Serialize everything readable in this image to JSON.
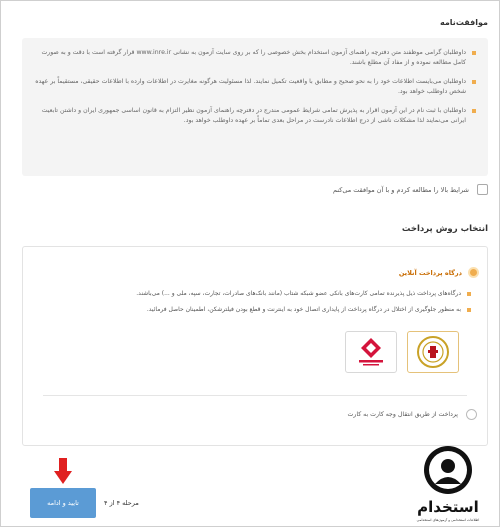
{
  "terms": {
    "title": "موافقت‌نامه",
    "items": [
      "داوطلبان گرامی موظفند متن دفترچه راهنمای آزمون استخدام بخش خصوصی را که بر روی سایت آزمون به نشانی www.inre.ir قرار گرفته است با دقت و به صورت کامل مطالعه نموده و از مفاد آن مطلع باشند.",
      "داوطلبان می‌بایست اطلاعات خود را به نحو صحیح و مطابق با واقعیت تکمیل نمایند. لذا مسئولیت هرگونه مغایرت در اطلاعات وارده با اطلاعات حقیقی، مستقیماً بر عهده شخص داوطلب خواهد بود.",
      "داوطلبان با ثبت نام در این آزمون اقرار به پذیرش تمامی شرایط عمومی مندرج در دفترچه راهنمای آزمون نظیر التزام به قانون اساسی جمهوری ایران و داشتن تابعیت ایرانی می‌نمایند لذا مشکلات ناشی از درج اطلاعات نادرست در مراحل بعدی تماماً بر عهده داوطلب خواهد بود."
    ]
  },
  "agree": {
    "label": "شرایط بالا را مطالعه کردم و با آن موافقت می‌کنم"
  },
  "payment": {
    "title": "انتخاب روش پرداخت",
    "gateway_label": "درگاه پرداخت آنلاین",
    "notes": [
      "درگاه‌های پرداخت ذیل پذیرنده تمامی کارت‌های بانکی عضو شبکه شتاب (مانند بانک‌های صادرات، تجارت، سپه، ملی و ...) می‌باشند.",
      "به منظور جلوگیری از اختلال در درگاه پرداخت از پایداری اتصال خود به اینترنت و قطع بودن فیلترشکن، اطمینان حاصل فرمائید."
    ],
    "banks": [
      {
        "name": "بانک ملی",
        "color": "#c9a227"
      },
      {
        "name": "بانک ملت",
        "color": "#d4143c"
      }
    ],
    "card_transfer_label": "پرداخت از طریق انتقال وجه کارت به کارت"
  },
  "footer": {
    "submit_label": "تایید و ادامه",
    "step_label": "مرحله ۴ از ۴"
  },
  "logo": {
    "text": "استخدام",
    "sub": "اطلاعات استخدامی و آزمون‌های استخدامی"
  },
  "colors": {
    "accent": "#f0ad4e",
    "button": "#5b9bd5",
    "arrow": "#e02020"
  }
}
